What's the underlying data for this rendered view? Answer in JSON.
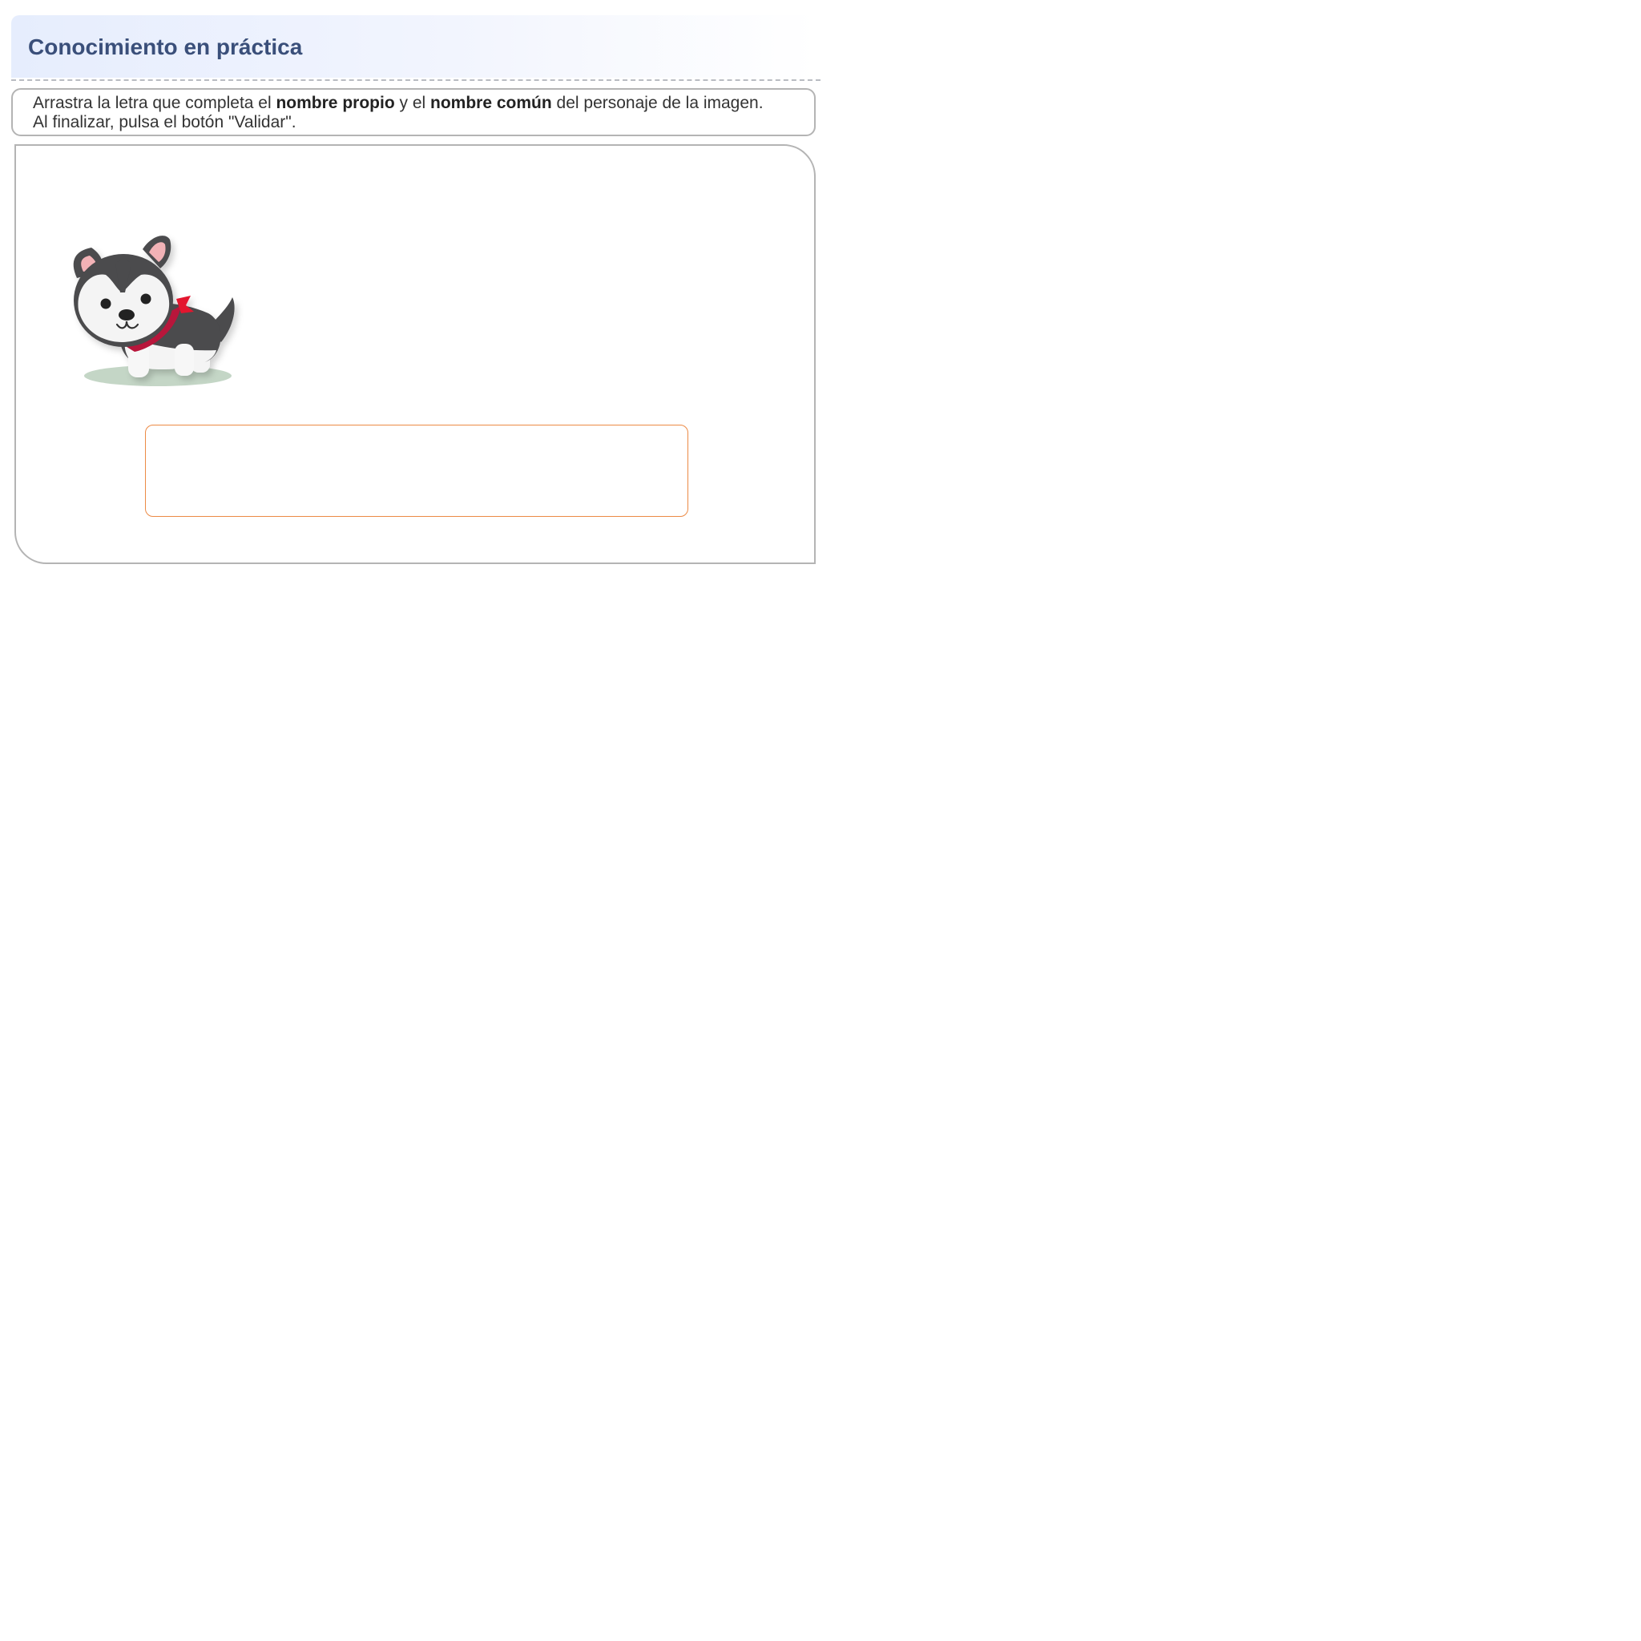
{
  "header": {
    "title": "Conocimiento en práctica"
  },
  "instructions": {
    "line1_part1": "Arrastra la letra que completa el ",
    "line1_bold1": "nombre propio",
    "line1_part2": " y el ",
    "line1_bold2": "nombre común",
    "line1_part3": " del personaje de la imagen.",
    "line2": "Al finalizar, pulsa el botón \"Validar\"."
  },
  "activity": {
    "image_icon": "husky-dog-with-red-bandana",
    "drop_zone_text": ""
  },
  "colors": {
    "title": "#3a4f7a",
    "drop_zone_border": "#ec8a45",
    "panel_border": "#b4b4b4"
  }
}
